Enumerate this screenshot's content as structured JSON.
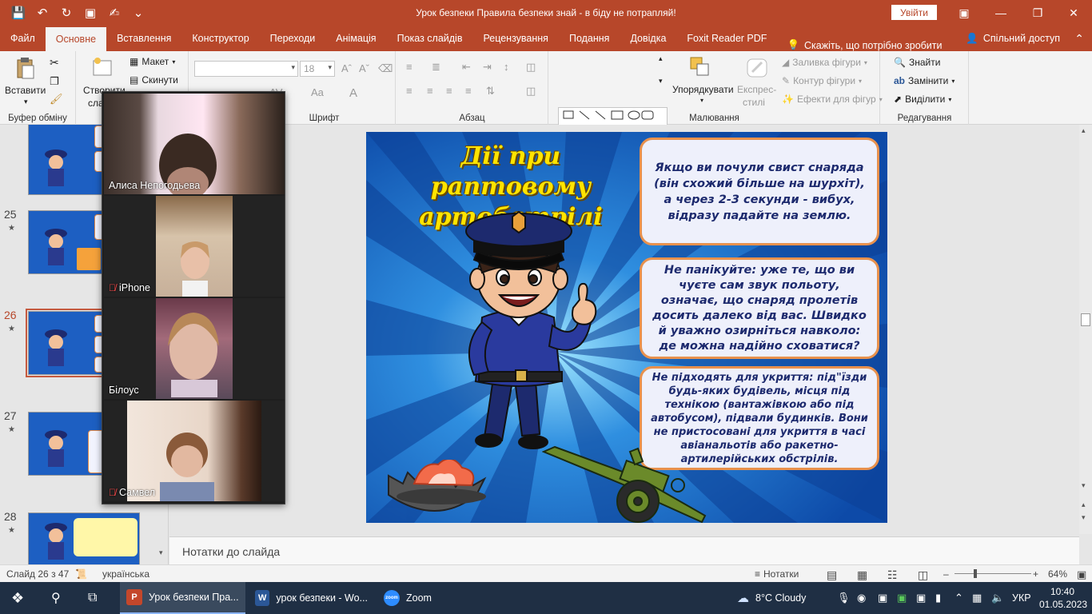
{
  "titlebar": {
    "title": "Урок безпеки Правила безпеки знай - в біду не потрапляй!",
    "signin": "Увійти"
  },
  "menu": {
    "tabs": [
      "Файл",
      "Основне",
      "Вставлення",
      "Конструктор",
      "Переходи",
      "Анімація",
      "Показ слайдів",
      "Рецензування",
      "Подання",
      "Довідка",
      "Foxit Reader PDF"
    ],
    "active_tab": "Основне",
    "tell_me": "Скажіть, що потрібно зробити",
    "share": "Спільний доступ"
  },
  "ribbon": {
    "clipboard": {
      "paste": "Вставити",
      "label": "Буфер обміну"
    },
    "slides": {
      "new_slide": "Створити",
      "new_slide2": "сла",
      "layout": "Макет",
      "reset": "Скинути"
    },
    "font": {
      "font_name": "",
      "font_size": "18",
      "label": "Шрифт"
    },
    "paragraph": {
      "label": "Абзац"
    },
    "drawing": {
      "arrange": "Упорядкувати",
      "quick_styles": "Експрес-",
      "quick_styles2": "стилі",
      "fill": "Заливка фігури",
      "outline": "Контур фігури",
      "effects": "Ефекти для фігур",
      "label": "Малювання"
    },
    "editing": {
      "find": "Знайти",
      "replace": "Замінити",
      "select": "Виділити",
      "label": "Редагування"
    }
  },
  "thumbnails": [
    {
      "num": "25"
    },
    {
      "num": "26"
    },
    {
      "num": "27"
    },
    {
      "num": "28"
    }
  ],
  "zoom": {
    "participants": [
      {
        "name": "Алиса Непогодьева",
        "muted": false
      },
      {
        "name": "iPhone",
        "muted": true
      },
      {
        "name": "Білоус",
        "muted": false
      },
      {
        "name": "Самвел",
        "muted": true
      }
    ]
  },
  "slide": {
    "title": "Дії при раптовому артобстрілі",
    "box1": "Якщо ви почули свист снаряда (він схожий більше на шурхіт), а через 2-3 секунди - вибух, відразу падайте на землю.",
    "box2": "Не панікуйте: уже те, що ви чуєте сам звук польоту, означає, що снаряд пролетів досить далеко від вас. Швидко й уважно озирніться навколо: де можна надійно сховатися?",
    "box3": "Не підходять для укриття: під\"їзди будь-яких будівель, місця під технікою (вантажівкою або під автобусом), підвали будинків. Вони не пристосовані для укриття в часі авіанальотів або ракетно-артилерійських обстрілів."
  },
  "notes": {
    "placeholder": "Нотатки до слайда"
  },
  "status": {
    "slide_info": "Слайд 26 з 47",
    "language": "українська",
    "notes_btn": "Нотатки",
    "zoom_level": "64%"
  },
  "taskbar": {
    "items": [
      {
        "label": "Урок безпеки Пра...",
        "app": "P",
        "color": "#c4472b"
      },
      {
        "label": "урок безпеки - Wo...",
        "app": "W",
        "color": "#2b5797"
      },
      {
        "label": "Zoom",
        "app": "zoom",
        "color": "#2d8cff"
      }
    ],
    "weather": "8°C  Cloudy",
    "lang": "УКР",
    "time": "10:40",
    "date": "01.05.2023"
  }
}
